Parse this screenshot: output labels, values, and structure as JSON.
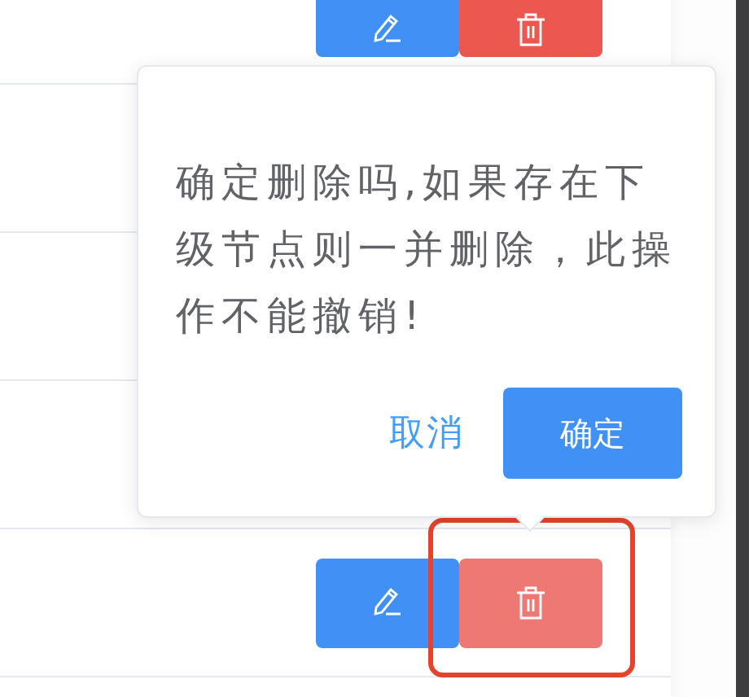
{
  "rows": [
    {
      "kind": "actions",
      "delete_hover": false,
      "highlighted": false
    },
    {
      "kind": "covered"
    },
    {
      "kind": "covered"
    },
    {
      "kind": "covered"
    },
    {
      "kind": "actions",
      "delete_hover": true,
      "highlighted": true
    },
    {
      "kind": "empty"
    }
  ],
  "popconfirm": {
    "message": "确定删除吗,如果存在下级节点则一并删除，此操作不能撤销!",
    "cancel": "取消",
    "confirm": "确定"
  }
}
